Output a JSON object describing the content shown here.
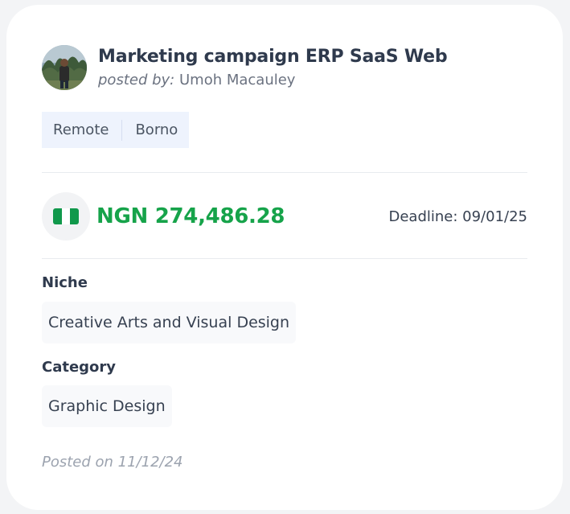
{
  "job": {
    "title": "Marketing campaign ERP SaaS Web",
    "posted_by_prefix": "posted by:",
    "poster_name": "Umoh Macauley",
    "tags": [
      "Remote",
      "Borno"
    ],
    "currency_flag_icon": "nigeria-flag-icon",
    "amount": "NGN 274,486.28",
    "deadline": "Deadline: 09/01/25",
    "niche_label": "Niche",
    "niche_value": "Creative Arts and Visual Design",
    "category_label": "Category",
    "category_value": "Graphic Design",
    "posted_on": "Posted on 11/12/24"
  },
  "colors": {
    "amount": "#16a34a",
    "tag_background": "#eef3fd",
    "title": "#2f3a4d",
    "flag_green": "#10984b"
  }
}
